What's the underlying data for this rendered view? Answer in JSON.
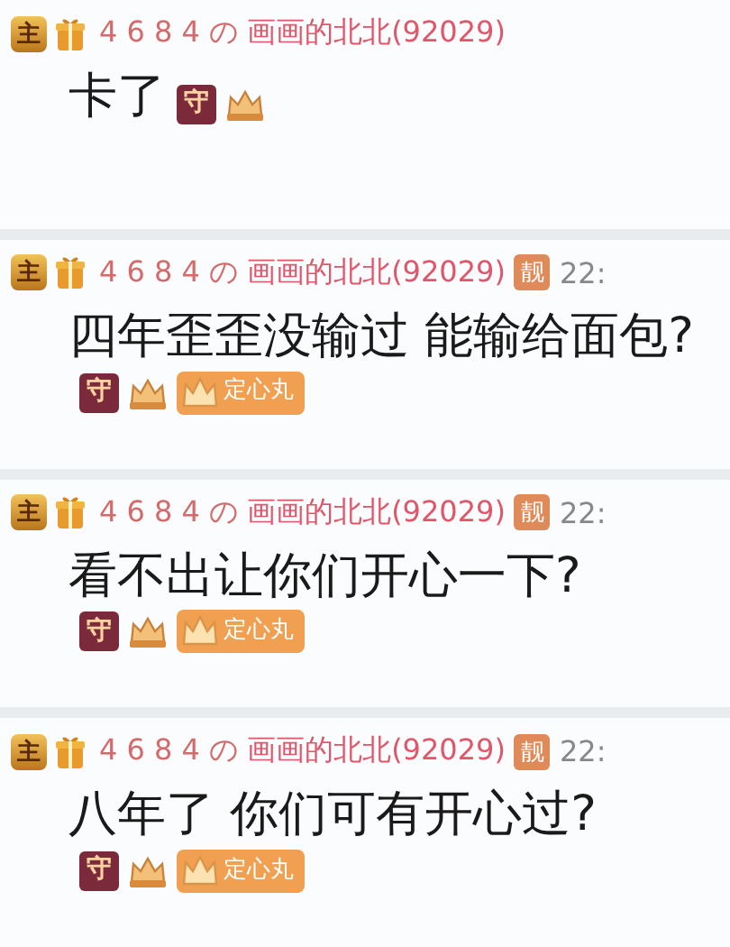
{
  "messages": [
    {
      "host_badge": "主",
      "user_id": "4 6 8 4 の",
      "nickname": "画画的北北(92029)",
      "text": "卡了",
      "guard_badge": "守"
    },
    {
      "host_badge": "主",
      "user_id": "4 6 8 4 の",
      "nickname": "画画的北北(92029)",
      "tag": "靓",
      "time": "22:",
      "text": "四年歪歪没输过 能输给面包?",
      "guard_badge": "守",
      "medal": "定心丸"
    },
    {
      "host_badge": "主",
      "user_id": "4 6 8 4 の",
      "nickname": "画画的北北(92029)",
      "tag": "靓",
      "time": "22:",
      "text": "看不出让你们开心一下?",
      "guard_badge": "守",
      "medal": "定心丸"
    },
    {
      "host_badge": "主",
      "user_id": "4 6 8 4 の",
      "nickname": "画画的北北(92029)",
      "tag": "靓",
      "time": "22:",
      "text": "八年了 你们可有开心过?",
      "guard_badge": "守",
      "medal": "定心丸"
    }
  ]
}
